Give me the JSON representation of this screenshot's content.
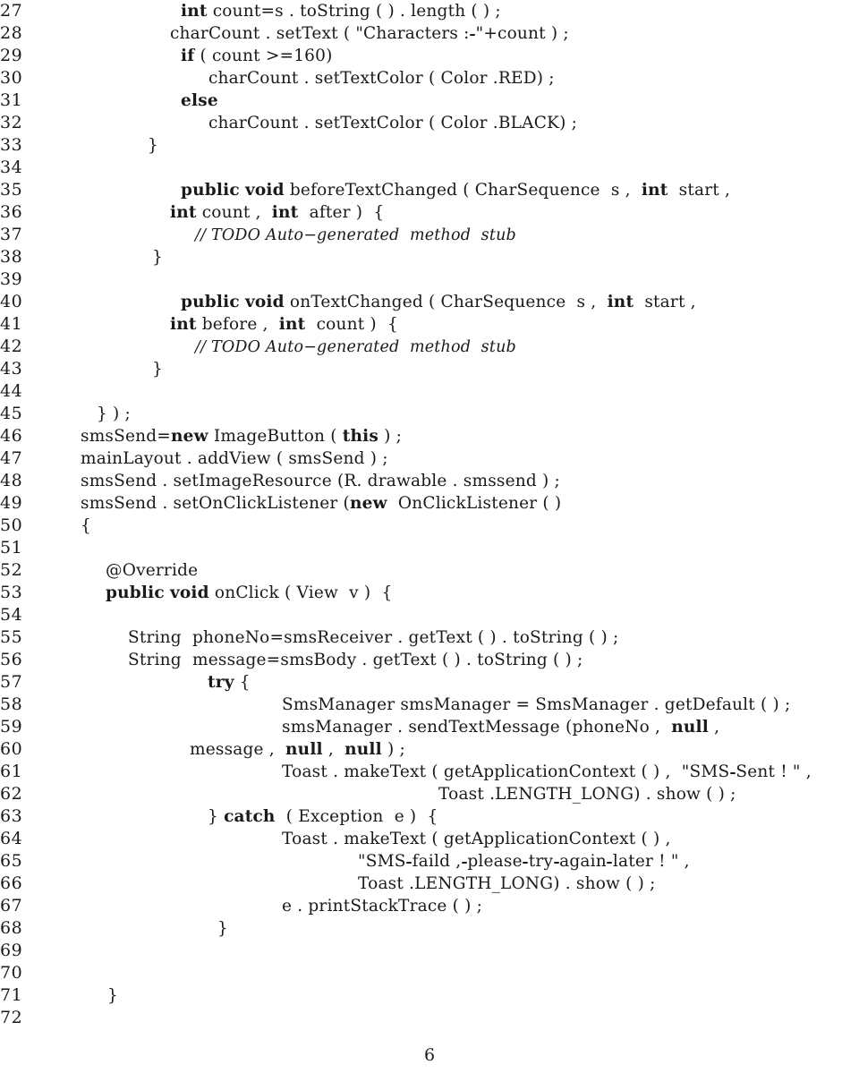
{
  "document": {
    "kind": "latex-code-listing",
    "language": "Java",
    "page_number": "6",
    "line_number_range": {
      "first": 27,
      "last": 72
    },
    "colors": {
      "text": "#1a1a1a",
      "background": "#ffffff"
    }
  },
  "listing": {
    "lines": [
      {
        "num": "27",
        "indent": 112,
        "html": "<span class=\"kw\">int</span> count=s . toString ( ) . length ( ) ;"
      },
      {
        "num": "28",
        "indent": 100,
        "html": "charCount . setText ( &quot;Characters :<span class=\"sp\"></span>&quot;+count ) ;"
      },
      {
        "num": "29",
        "indent": 112,
        "html": "<span class=\"kw\">if</span> ( count &gt;=160)"
      },
      {
        "num": "30",
        "indent": 143,
        "html": "charCount . setTextColor ( Color .RED) ;"
      },
      {
        "num": "31",
        "indent": 112,
        "html": "<span class=\"kw\">else</span>"
      },
      {
        "num": "32",
        "indent": 143,
        "html": "charCount . setTextColor ( Color .BLACK) ;"
      },
      {
        "num": "33",
        "indent": 75,
        "html": "}"
      },
      {
        "num": "34",
        "indent": 0,
        "html": ""
      },
      {
        "num": "35",
        "indent": 112,
        "html": "<span class=\"kw\">public</span> <span class=\"kw\">void</span> beforeTextChanged ( CharSequence  s ,  <span class=\"kw\">int</span>  start ,"
      },
      {
        "num": "36",
        "indent": 100,
        "html": "<span class=\"kw\">int</span> count ,  <span class=\"kw\">int</span>  after )  {"
      },
      {
        "num": "37",
        "indent": 128,
        "html": "<span class=\"cmt\">// TODO Auto&minus;generated  method  stub</span>"
      },
      {
        "num": "38",
        "indent": 80,
        "html": "}"
      },
      {
        "num": "39",
        "indent": 0,
        "html": ""
      },
      {
        "num": "40",
        "indent": 112,
        "html": "<span class=\"kw\">public</span> <span class=\"kw\">void</span> onTextChanged ( CharSequence  s ,  <span class=\"kw\">int</span>  start ,"
      },
      {
        "num": "41",
        "indent": 100,
        "html": "<span class=\"kw\">int</span> before ,  <span class=\"kw\">int</span>  count )  {"
      },
      {
        "num": "42",
        "indent": 128,
        "html": "<span class=\"cmt\">// TODO Auto&minus;generated  method  stub</span>"
      },
      {
        "num": "43",
        "indent": 80,
        "html": "}"
      },
      {
        "num": "44",
        "indent": 0,
        "html": ""
      },
      {
        "num": "45",
        "indent": 18,
        "html": "} ) ;"
      },
      {
        "num": "46",
        "indent": 0,
        "html": "smsSend=<span class=\"kw\">new</span> ImageButton ( <span class=\"kw\">this</span> ) ;"
      },
      {
        "num": "47",
        "indent": 0,
        "html": "mainLayout . addView ( smsSend ) ;"
      },
      {
        "num": "48",
        "indent": 0,
        "html": "smsSend . setImageResource (R. drawable . smssend ) ;"
      },
      {
        "num": "49",
        "indent": 0,
        "html": "smsSend . setOnClickListener (<span class=\"kw\">new</span>  OnClickListener ( )"
      },
      {
        "num": "50",
        "indent": 0,
        "html": "{"
      },
      {
        "num": "51",
        "indent": 0,
        "html": ""
      },
      {
        "num": "52",
        "indent": 28,
        "html": "@Override"
      },
      {
        "num": "53",
        "indent": 28,
        "html": "<span class=\"kw\">public</span> <span class=\"kw\">void</span> onClick ( View  v )  {"
      },
      {
        "num": "54",
        "indent": 0,
        "html": ""
      },
      {
        "num": "55",
        "indent": 53,
        "html": "String  phoneNo=smsReceiver . getText ( ) . toString ( ) ;"
      },
      {
        "num": "56",
        "indent": 53,
        "html": "String  message=smsBody . getText ( ) . toString ( ) ;"
      },
      {
        "num": "57",
        "indent": 142,
        "html": "<span class=\"kw\">try</span> {"
      },
      {
        "num": "58",
        "indent": 225,
        "html": "SmsManager smsManager = SmsManager . getDefault ( ) ;"
      },
      {
        "num": "59",
        "indent": 225,
        "html": "smsManager . sendTextMessage (phoneNo ,  <span class=\"kw\">null</span> ,"
      },
      {
        "num": "60",
        "indent": 122,
        "html": "message ,  <span class=\"kw\">null</span> ,  <span class=\"kw\">null</span> ) ;"
      },
      {
        "num": "61",
        "indent": 225,
        "html": "Toast . makeText ( getApplicationContext ( ) ,  &quot;SMS<span class=\"sp\"></span>Sent ! &quot; ,"
      },
      {
        "num": "62",
        "indent": 400,
        "html": "Toast .LENGTH_LONG) . show ( ) ;"
      },
      {
        "num": "63",
        "indent": 142,
        "html": "} <span class=\"kw\">catch</span>  ( Exception  e )  {"
      },
      {
        "num": "64",
        "indent": 225,
        "html": "Toast . makeText ( getApplicationContext ( ) ,"
      },
      {
        "num": "65",
        "indent": 310,
        "html": "&quot;SMS<span class=\"sp\"></span>faild ,<span class=\"sp\"></span>please<span class=\"sp\"></span>try<span class=\"sp\"></span>again<span class=\"sp\"></span>later ! &quot; ,"
      },
      {
        "num": "66",
        "indent": 310,
        "html": "Toast .LENGTH_LONG) . show ( ) ;"
      },
      {
        "num": "67",
        "indent": 225,
        "html": "e . printStackTrace ( ) ;"
      },
      {
        "num": "68",
        "indent": 153,
        "html": "}"
      },
      {
        "num": "69",
        "indent": 0,
        "html": ""
      },
      {
        "num": "70",
        "indent": 0,
        "html": ""
      },
      {
        "num": "71",
        "indent": 30,
        "html": "}"
      },
      {
        "num": "72",
        "indent": 0,
        "html": ""
      }
    ]
  }
}
